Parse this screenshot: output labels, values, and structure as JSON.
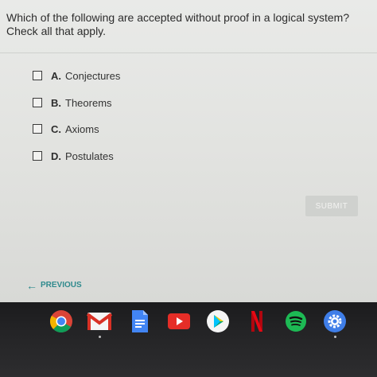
{
  "question": {
    "text": "Which of the following are accepted without proof in a logical system? Check all that apply."
  },
  "options": [
    {
      "letter": "A.",
      "label": "Conjectures"
    },
    {
      "letter": "B.",
      "label": "Theorems"
    },
    {
      "letter": "C.",
      "label": "Axioms"
    },
    {
      "letter": "D.",
      "label": "Postulates"
    }
  ],
  "submit_label": "SUBMIT",
  "previous_label": "PREVIOUS",
  "shelf_apps": [
    "chrome-icon",
    "gmail-icon",
    "docs-icon",
    "youtube-icon",
    "play-store-icon",
    "netflix-icon",
    "spotify-icon",
    "settings-icon"
  ],
  "colors": {
    "accent": "#2f8a8d",
    "submit_disabled": "#cfd1ce"
  }
}
